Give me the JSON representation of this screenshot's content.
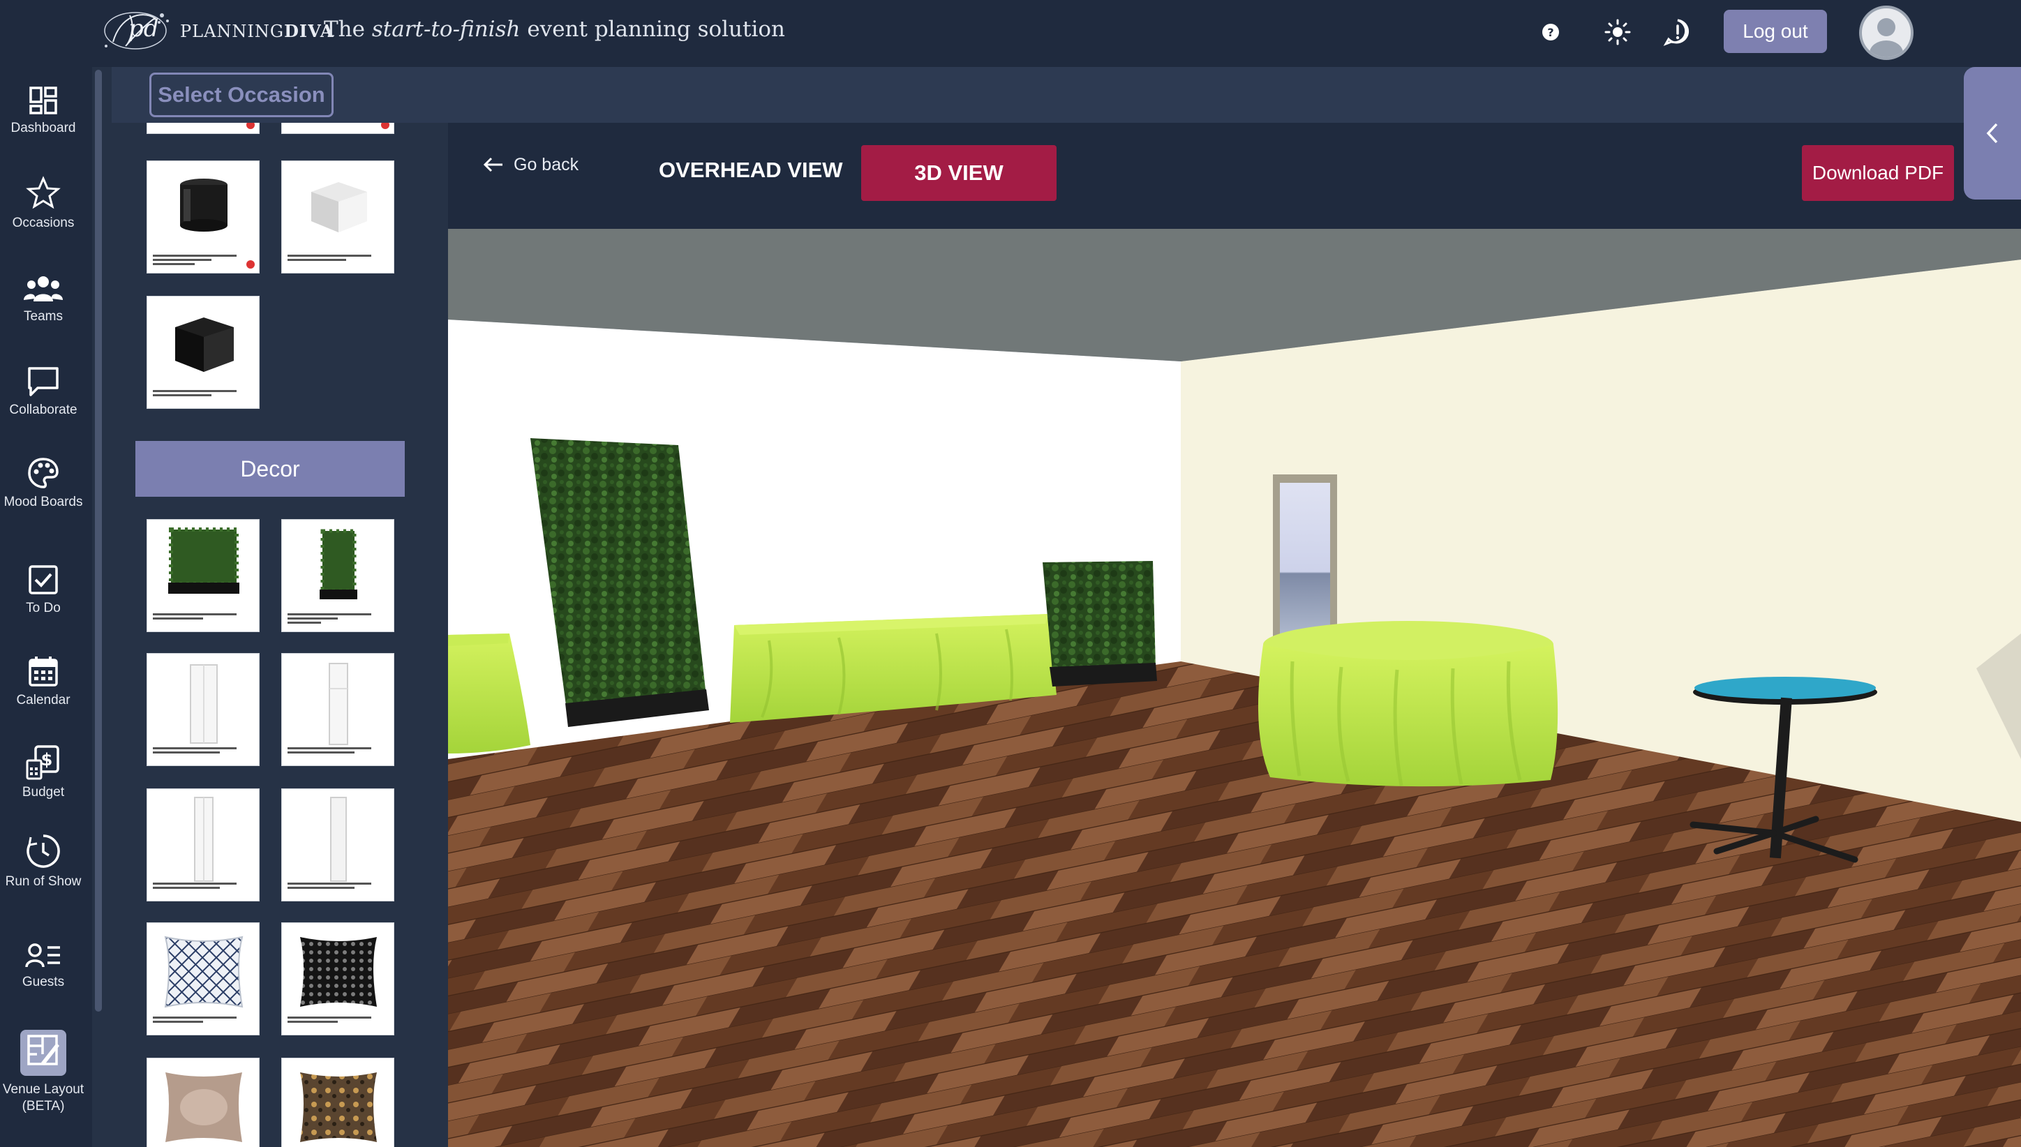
{
  "header": {
    "brand_light": "PLANNING",
    "brand_bold": "DIVA",
    "tagline_prefix": "The ",
    "tagline_emph": "start-to-finish",
    "tagline_suffix": " event planning solution",
    "help_icon": "help-circle-icon",
    "theme_icon": "sun-icon",
    "feedback_icon": "alert-bubble-icon",
    "logout_label": "Log out"
  },
  "sidebar": {
    "items": [
      {
        "label": "Dashboard",
        "icon": "dashboard-icon"
      },
      {
        "label": "Occasions",
        "icon": "star-icon"
      },
      {
        "label": "Teams",
        "icon": "people-icon"
      },
      {
        "label": "Collaborate",
        "icon": "chat-icon"
      },
      {
        "label": "Mood Boards",
        "icon": "palette-icon"
      },
      {
        "label": "To Do",
        "icon": "checkbox-icon"
      },
      {
        "label": "Calendar",
        "icon": "calendar-icon"
      },
      {
        "label": "Budget",
        "icon": "budget-icon"
      },
      {
        "label": "Run of Show",
        "icon": "clock-icon"
      },
      {
        "label": "Guests",
        "icon": "guests-icon"
      },
      {
        "label": "Venue Layout (BETA)",
        "icon": "layout-icon"
      }
    ]
  },
  "occasion": {
    "select_label": "Select Occasion"
  },
  "panel": {
    "section_title": "Decor"
  },
  "view": {
    "go_back": "Go back",
    "overhead_label": "OVERHEAD VIEW",
    "view3d_label": "3D VIEW",
    "download_label": "Download PDF"
  },
  "colors": {
    "accent": "#a31c45",
    "lavender": "#7b7fb0",
    "nav_bg": "#1f2a3e",
    "linen": "#b8e04a"
  }
}
